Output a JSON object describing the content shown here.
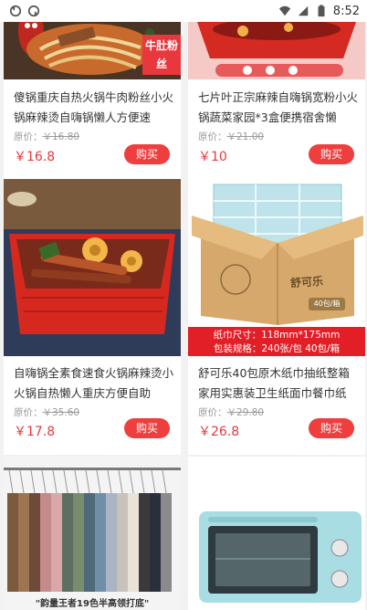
{
  "status_bar": {
    "time": "8:52"
  },
  "products": [
    {
      "title": "傻锅重庆自热火锅牛肉粉丝小火锅麻辣烫自嗨锅懒人方便速",
      "orig_label": "原价：",
      "orig_price": "￥16.80",
      "price": "￥16.8",
      "buy_label": "购买",
      "image_tag": "牛肚粉丝"
    },
    {
      "title": "七片叶正宗麻辣自嗨锅宽粉小火锅蔬菜家园*3盒便携宿舍懒",
      "orig_label": "原价：",
      "orig_price": "￥21.00",
      "price": "￥10",
      "buy_label": "购买"
    },
    {
      "title": "自嗨锅全素食速食火锅麻辣烫小火锅自热懒人重庆方便自助",
      "orig_label": "原价：",
      "orig_price": "￥35.60",
      "price": "￥17.8",
      "buy_label": "购买"
    },
    {
      "title": "舒可乐40包原木纸巾抽纸整箱家用实惠装卫生纸面巾餐巾纸",
      "orig_label": "原价：",
      "orig_price": "￥29.80",
      "price": "￥26.8",
      "buy_label": "购买",
      "image_spec_1": "纸巾尺寸：118mm*175mm",
      "image_spec_2": "包装规格：240张/包  40包/箱",
      "box_brand": "舒可乐",
      "box_count": "40包/箱"
    },
    {
      "image_caption": "\"韵量王者19色半高领打底\""
    },
    {}
  ],
  "colors": {
    "accent": "#ef3e3e",
    "price": "#e8383d"
  }
}
